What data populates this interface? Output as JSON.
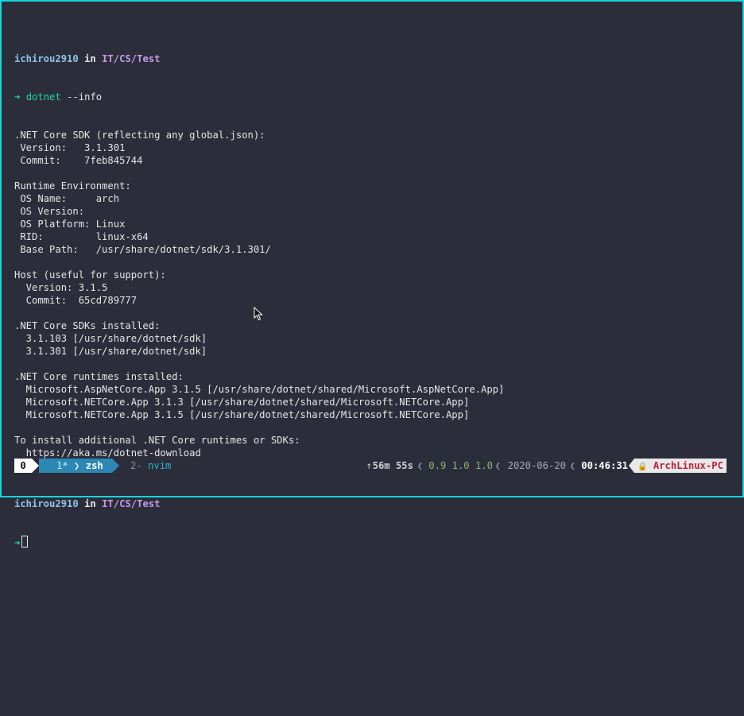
{
  "prompt1": {
    "user": "ichirou2910",
    "in": "in",
    "path": "IT/CS/Test"
  },
  "command": {
    "arrow": "➜",
    "program": "dotnet",
    "args": "--info"
  },
  "output": [
    ".NET Core SDK (reflecting any global.json):",
    " Version:   3.1.301",
    " Commit:    7feb845744",
    "",
    "Runtime Environment:",
    " OS Name:     arch",
    " OS Version:",
    " OS Platform: Linux",
    " RID:         linux-x64",
    " Base Path:   /usr/share/dotnet/sdk/3.1.301/",
    "",
    "Host (useful for support):",
    "  Version: 3.1.5",
    "  Commit:  65cd789777",
    "",
    ".NET Core SDKs installed:",
    "  3.1.103 [/usr/share/dotnet/sdk]",
    "  3.1.301 [/usr/share/dotnet/sdk]",
    "",
    ".NET Core runtimes installed:",
    "  Microsoft.AspNetCore.App 3.1.5 [/usr/share/dotnet/shared/Microsoft.AspNetCore.App]",
    "  Microsoft.NETCore.App 3.1.3 [/usr/share/dotnet/shared/Microsoft.NETCore.App]",
    "  Microsoft.NETCore.App 3.1.5 [/usr/share/dotnet/shared/Microsoft.NETCore.App]",
    "",
    "To install additional .NET Core runtimes or SDKs:",
    "  https://aka.ms/dotnet-download",
    ""
  ],
  "prompt2": {
    "user": "ichirou2910",
    "in": "in",
    "path": "IT/CS/Test",
    "arrow": "➜"
  },
  "status_bar": {
    "session": "0",
    "window1": {
      "index": "1*",
      "name": "zsh"
    },
    "window2": {
      "index": "2-",
      "name": "nvim"
    },
    "up_icon": "↑",
    "elapsed": "56m 55s",
    "load": "0.9 1.0 1.0",
    "date": "2020-06-20",
    "time": "00:46:31",
    "host_icon": "🔒",
    "host": "ArchLinux-PC"
  },
  "colors": {
    "frame_border": "#17d4dc",
    "background": "#2b2d3a",
    "accent_green": "#27d796",
    "window_active": "#2b88b3"
  },
  "icons": {
    "mouse_pointer": "arrow-cursor-icon",
    "lock": "lock-icon"
  }
}
